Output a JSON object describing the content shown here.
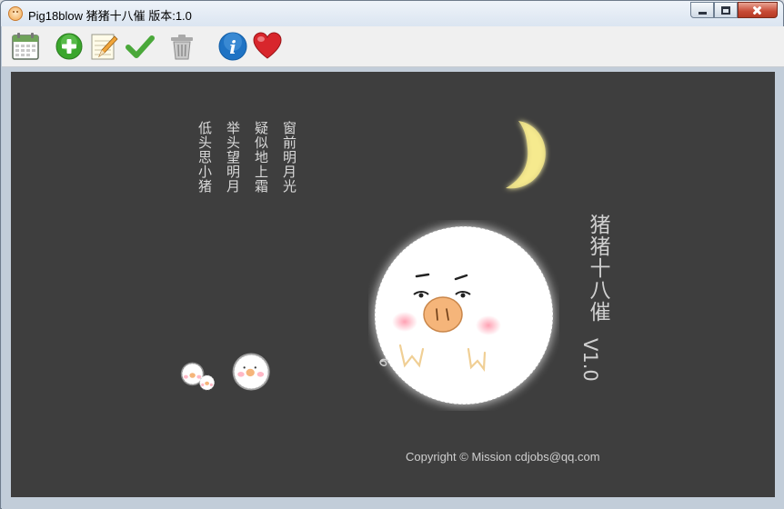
{
  "window": {
    "title": "Pig18blow 猪猪十八催 版本:1.0",
    "controls": [
      "minimize",
      "maximize",
      "close"
    ]
  },
  "toolbar": {
    "items": [
      {
        "icon": "calendar-icon"
      },
      {
        "icon": "add-icon"
      },
      {
        "icon": "edit-icon"
      },
      {
        "icon": "check-icon"
      },
      {
        "icon": "trash-icon"
      },
      {
        "icon": "info-icon"
      },
      {
        "icon": "heart-icon"
      }
    ]
  },
  "splash": {
    "poem_lines": [
      "窗前明月光",
      "疑似地上霜",
      "举头望明月",
      "低头思小猪"
    ],
    "brand_title": "猪猪十八催",
    "version": "V1.0",
    "copyright": "Copyright © Mission cdjobs@qq.com"
  },
  "colors": {
    "canvas_bg": "#3e3e3e",
    "moon": "#f6e98a",
    "text": "#cfcfcf",
    "accent_add": "#3aa62c",
    "accent_info": "#1f73c4",
    "accent_heart": "#d8262c"
  }
}
